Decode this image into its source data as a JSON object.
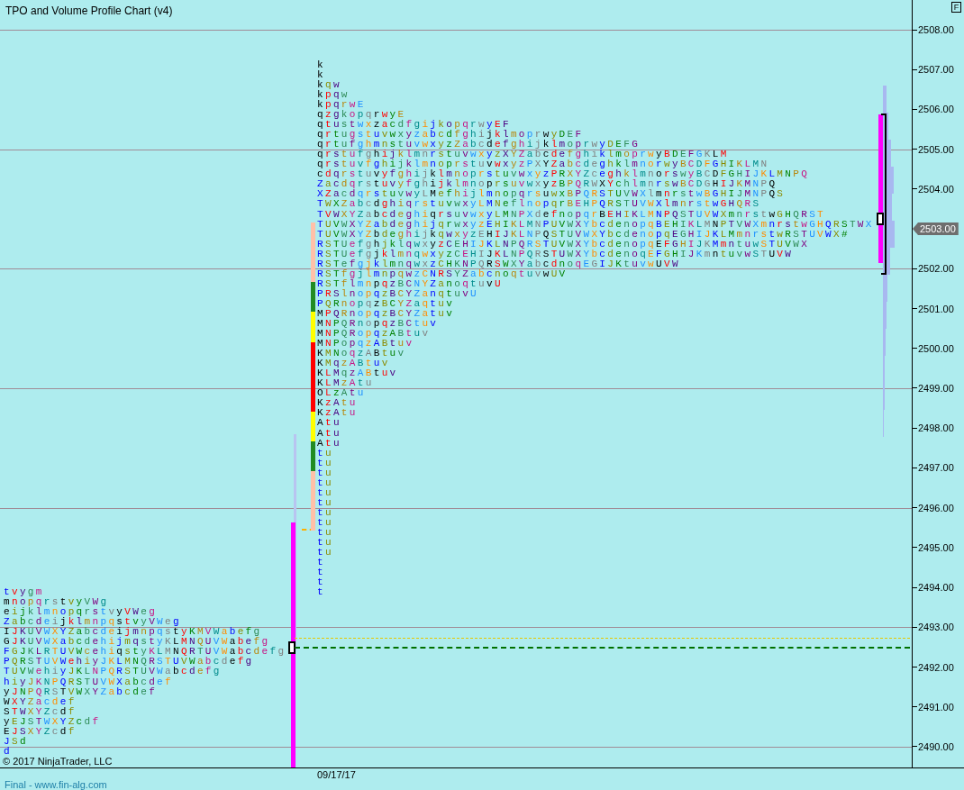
{
  "window": {
    "title": "TPO and Volume Profile Chart (v4)",
    "corner_button": "F"
  },
  "price_axis": {
    "labels": [
      {
        "text": "2508.00",
        "current": false
      },
      {
        "text": "2507.00",
        "current": false
      },
      {
        "text": "2506.00",
        "current": false
      },
      {
        "text": "2505.00",
        "current": false
      },
      {
        "text": "2504.00",
        "current": false
      },
      {
        "text": "2503.00",
        "current": true
      },
      {
        "text": "2502.00",
        "current": false
      },
      {
        "text": "2501.00",
        "current": false
      },
      {
        "text": "2500.00",
        "current": false
      },
      {
        "text": "2499.00",
        "current": false
      },
      {
        "text": "2498.00",
        "current": false
      },
      {
        "text": "2497.00",
        "current": false
      },
      {
        "text": "2496.00",
        "current": false
      },
      {
        "text": "2495.00",
        "current": false
      },
      {
        "text": "2494.00",
        "current": false
      },
      {
        "text": "2493.00",
        "current": false
      },
      {
        "text": "2492.00",
        "current": false
      },
      {
        "text": "2491.00",
        "current": false
      },
      {
        "text": "2490.00",
        "current": false
      }
    ]
  },
  "profiles": [
    {
      "kind": "main",
      "rows": [
        "k",
        "k",
        "kqw",
        "kpqw",
        "kpqrwE",
        "qzgkopqrwyE",
        "qtustwxzacdfgijkopqrwyEF",
        "qrtugstuvwxyzabcdfghijklmoprwyDEF",
        "qrtufghmnstuvwxyzZabcdefghijklmoprwyDEFG",
        "qrstufghijklmnrstuvwxyzXYZabcdefghiklmoprwyBDEFGKLM",
        "qrstuvfghijklmnoprstuvwxyzPXYZabcdeghklmnorwyBCDFGHIKLMN",
        "cdqrstuvyfghijklmnoprstuvwxyzPRXYZceghklmnorswyBCDFGHIJKLMNPQ",
        "ZacdqrstuvyfghijklmnoprsuvwxyzBPQRWXYchlmnrswBCDGHIJKMNPQ",
        "XZacdqrstuvwyLMefhijlmnopqrsuwxBPQRSTUVWXlmnrstwBGHIJMNPQS",
        "TWXZabcdghiqrstuvwxyLMNeflnopqrBEHPQRSTUVWXlmnrstwGHQRS",
        "TVWXYZabcdeghiqrsuvwxyLMNPXdefnopqrBEHIKLMNPQSTUVWXmnrstwGHQRST",
        "TUVWXYZabdeghijqrwxyzEHIKLMNPUVWXYbcdenopqBEHIKLMNPTVWXmnrstwGHQRSTWX",
        "TUVWXYZbdeghijkqwxyzEHIJKLNPQSTUVWXYbcdenopqEGHIJKLMmnrstwRSTUVWX#",
        "RSTUefghjklqwxyzCEHIJKLNPQRSTUVWXYbcdenopqEFGHIJKMmntuwSTUVWX",
        "RSTUefgjklmnqwxyzCEHIJKLNPQRSTUWXYbcdenoqEFGHIJKmntuvwSTUVW",
        "RSTefgjklmnqwxzCHKNPQRSWXYabcdnoqEGIJKtuvwUVW",
        "RSTfgjlmnpqwzCNRSYZabcnoqtuvwUV",
        "RSTflmnpqzBCNYZanoqtuvU",
        "PRSlnopqzBCYZanqtuvU",
        "PQRnopqzBCYZaqtuv",
        "MPQRnopqzBCYZatuv",
        "MNPQRnopqzBCtuv",
        "MNPQRopqzABtuv",
        "MNPopqzABtuv",
        "KMNoqzABtuv",
        "KMqzABtuv",
        "KLMqzABtuv",
        "KLMzAtu",
        "OLzAtu",
        "KzAtu",
        "KzAtu",
        "Atu",
        "Atu",
        "Atu",
        "tu",
        "tu",
        "tu",
        "tu",
        "tu",
        "tu",
        "tu",
        "tu",
        "tu",
        "tu",
        "tu",
        "t",
        "t",
        "t",
        "t"
      ]
    },
    {
      "kind": "previous",
      "rows": [
        "tvygm",
        "mnopqrstvyVWg",
        "eijklmnopqrstvyVWeg",
        "ZabcdeijklmnpqstvyVWeg",
        "IJKUVWXYZabcdeijmnpqstyKMVWabefg",
        "GJKUVWXabcdehijmqstyKLMNQUVWabefg",
        "FGJKLRTUVWcehiqstyKLMNQRTUVWabcdefg",
        "PQRSTUVWehiyJKLMNQRSTUVWabcdefg",
        "TUVWehiyJKLNPQRSTUVWabcdefg",
        "hiyJKNPQRSTUVWXabcdef",
        "yJNPQRSTVWXYZabcdef",
        "WXYZacdef",
        "STWXYZcdf",
        "yEJSTWXYZcdf",
        "EJSXYZcdf",
        "JSd",
        "d"
      ]
    }
  ],
  "period_bar": [
    {
      "color": "#ffc0a8"
    },
    {
      "color": "#ffc0a8"
    },
    {
      "color": "#ffc0a8"
    },
    {
      "color": "#ffc0a8"
    },
    {
      "color": "#ffc0a8"
    },
    {
      "color": "#ffc0a8"
    },
    {
      "color": "#228b22"
    },
    {
      "color": "#228b22"
    },
    {
      "color": "#228b22"
    },
    {
      "color": "#ffff00"
    },
    {
      "color": "#ffff00"
    },
    {
      "color": "#ffff00"
    },
    {
      "color": "#ff0000"
    },
    {
      "color": "#ff0000"
    },
    {
      "color": "#ff0000"
    },
    {
      "color": "#ff0000"
    },
    {
      "color": "#ff0000"
    },
    {
      "color": "#ff0000"
    },
    {
      "color": "#ff0000"
    },
    {
      "color": "#ffff00"
    },
    {
      "color": "#ffff00"
    },
    {
      "color": "#ffff00"
    },
    {
      "color": "#228b22"
    },
    {
      "color": "#228b22"
    },
    {
      "color": "#228b22"
    },
    {
      "color": "#ffc0a8"
    },
    {
      "color": "#ffc0a8"
    },
    {
      "color": "#ffc0a8"
    },
    {
      "color": "#ffc0a8"
    },
    {
      "color": "#ffc0a8"
    },
    {
      "color": "#ffc0a8"
    }
  ],
  "date_label": "09/17/17",
  "copyright": "© 2017 NinjaTrader, LLC",
  "footer": "Final - www.fin-alg.com"
}
